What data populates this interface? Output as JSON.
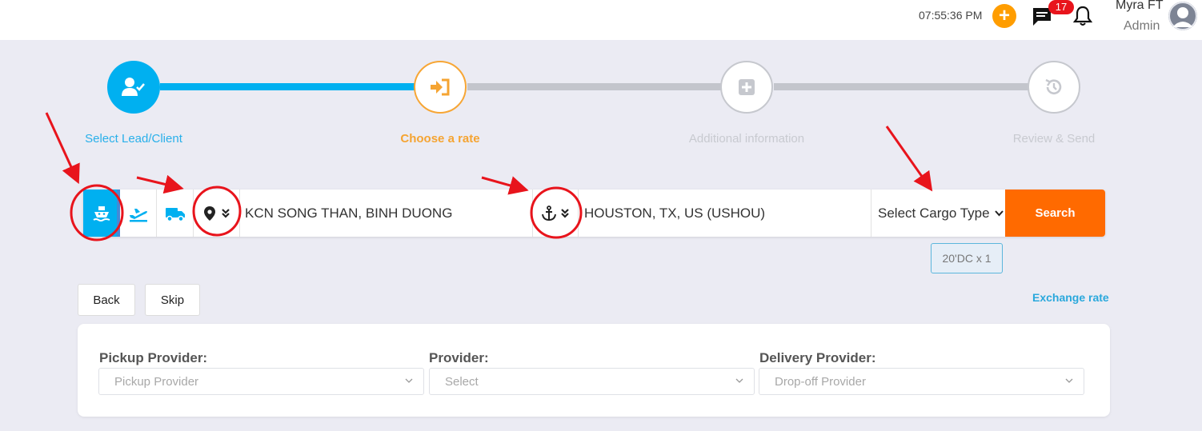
{
  "topbar": {
    "time": "07:55:36 PM",
    "plus_icon": "plus-circle-icon",
    "message_badge": "17",
    "user_name": "Myra FT",
    "user_role": "Admin"
  },
  "stepper": {
    "steps": [
      {
        "label": "Select Lead/Client",
        "icon": "user-check-icon",
        "state": "done"
      },
      {
        "label": "Choose a rate",
        "icon": "sign-in-icon",
        "state": "active"
      },
      {
        "label": "Additional information",
        "icon": "plus-square-icon",
        "state": "pending"
      },
      {
        "label": "Review & Send",
        "icon": "history-icon",
        "state": "pending"
      }
    ]
  },
  "search": {
    "modes": [
      "sea",
      "air",
      "truck"
    ],
    "selected_mode": "sea",
    "origin_type_icon": "map-marker-icon",
    "origin": "KCN SONG THAN, BINH DUONG",
    "destination_type_icon": "anchor-icon",
    "destination": "HOUSTON, TX, US (USHOU)",
    "cargo_type_placeholder": "Select Cargo Type",
    "search_label": "Search",
    "cargo_tag": "20'DC x 1"
  },
  "actions": {
    "back_label": "Back",
    "skip_label": "Skip",
    "exchange_rate_label": "Exchange rate"
  },
  "providers": {
    "pickup_label": "Pickup Provider:",
    "pickup_placeholder": "Pickup Provider",
    "provider_label": "Provider:",
    "provider_placeholder": "Select",
    "delivery_label": "Delivery Provider:",
    "delivery_placeholder": "Drop-off Provider"
  },
  "colors": {
    "accent_blue": "#00b0f0",
    "accent_orange": "#ff6a00",
    "step_active": "#f7a635",
    "annotation_red": "#e8141c"
  }
}
